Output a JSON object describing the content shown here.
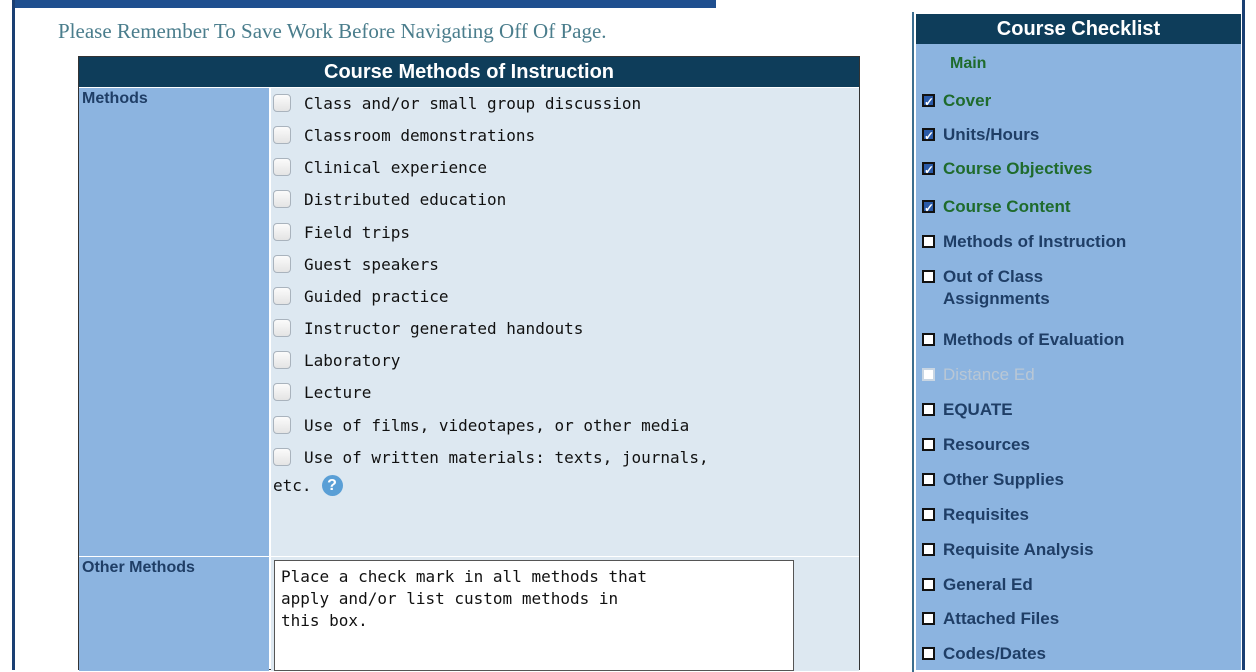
{
  "notice": "Please Remember To Save Work Before Navigating Off Of Page.",
  "form": {
    "title": "Course Methods of Instruction",
    "methods_label": "Methods",
    "methods": [
      "Class and/or small group discussion",
      "Classroom demonstrations",
      "Clinical experience",
      "Distributed education",
      "Field trips",
      "Guest speakers",
      "Guided practice",
      "Instructor generated handouts",
      "Laboratory",
      "Lecture",
      "Use of films, videotapes, or other media"
    ],
    "last_method_line1": "Use of written materials: texts, journals,",
    "last_method_line2": "etc.",
    "help_icon": "help-icon",
    "other_label": "Other Methods",
    "other_value": "Place a check mark in all methods that\napply and/or list custom methods in\nthis box."
  },
  "checklist": {
    "title": "Course Checklist",
    "main_label": "Main",
    "items": [
      {
        "label": "Cover",
        "state": "checked",
        "color": "#1f6b2c"
      },
      {
        "label": "Units/Hours",
        "state": "checked",
        "color": "#1f3e66"
      },
      {
        "label": "Course Objectives",
        "state": "checked",
        "color": "#1f6b2c"
      },
      {
        "label": "Course Content",
        "state": "checked",
        "color": "#1f6b2c"
      },
      {
        "label": "Methods of Instruction",
        "state": "unchecked",
        "color": "#1f3e66"
      },
      {
        "label": "Out of Class Assignments",
        "state": "unchecked",
        "color": "#1f3e66"
      },
      {
        "label": "Methods of Evaluation",
        "state": "unchecked",
        "color": "#1f3e66"
      },
      {
        "label": "Distance Ed",
        "state": "disabled",
        "color": "#b9c7d5"
      },
      {
        "label": "EQUATE",
        "state": "unchecked",
        "color": "#1f3e66"
      },
      {
        "label": "Resources",
        "state": "unchecked",
        "color": "#1f3e66"
      },
      {
        "label": "Other Supplies",
        "state": "unchecked",
        "color": "#1f3e66"
      },
      {
        "label": "Requisites",
        "state": "unchecked",
        "color": "#1f3e66"
      },
      {
        "label": "Requisite Analysis",
        "state": "unchecked",
        "color": "#1f3e66"
      },
      {
        "label": "General Ed",
        "state": "unchecked",
        "color": "#1f3e66"
      },
      {
        "label": "Attached Files",
        "state": "unchecked",
        "color": "#1f3e66"
      },
      {
        "label": "Codes/Dates",
        "state": "unchecked",
        "color": "#1f3e66"
      }
    ]
  }
}
